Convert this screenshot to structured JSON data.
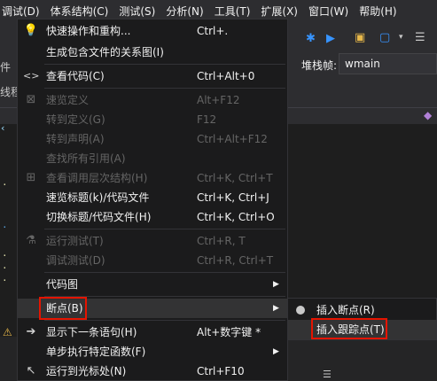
{
  "menubar": {
    "items": [
      "调试(D)",
      "体系结构(C)",
      "测试(S)",
      "分析(N)",
      "工具(T)",
      "扩展(X)",
      "窗口(W)",
      "帮助(H)"
    ]
  },
  "toolbar": {
    "stack_frame_label": "堆栈帧:",
    "stack_frame_value": "wmain",
    "fragments": [
      "件",
      "线程"
    ]
  },
  "context_menu": {
    "items": [
      {
        "label": "快速操作和重构...",
        "shortcut": "Ctrl+.",
        "icon": "lightbulb-icon",
        "enabled": true
      },
      {
        "label": "生成包含文件的关系图(I)",
        "shortcut": "",
        "icon": "",
        "enabled": true
      },
      {
        "label": "查看代码(C)",
        "shortcut": "Ctrl+Alt+0",
        "icon": "code-brackets-icon",
        "enabled": true
      },
      {
        "label": "速览定义",
        "shortcut": "Alt+F12",
        "icon": "peek-definition-icon",
        "enabled": false
      },
      {
        "label": "转到定义(G)",
        "shortcut": "F12",
        "icon": "",
        "enabled": false
      },
      {
        "label": "转到声明(A)",
        "shortcut": "Ctrl+Alt+F12",
        "icon": "",
        "enabled": false
      },
      {
        "label": "查找所有引用(A)",
        "shortcut": "",
        "icon": "",
        "enabled": false
      },
      {
        "label": "查看调用层次结构(H)",
        "shortcut": "Ctrl+K, Ctrl+T",
        "icon": "call-hierarchy-icon",
        "enabled": false
      },
      {
        "label": "速览标题(k)/代码文件",
        "shortcut": "Ctrl+K, Ctrl+J",
        "icon": "",
        "enabled": true
      },
      {
        "label": "切换标题/代码文件(H)",
        "shortcut": "Ctrl+K, Ctrl+O",
        "icon": "",
        "enabled": true
      },
      {
        "label": "运行测试(T)",
        "shortcut": "Ctrl+R, T",
        "icon": "run-test-icon",
        "enabled": false
      },
      {
        "label": "调试测试(D)",
        "shortcut": "Ctrl+R, Ctrl+T",
        "icon": "",
        "enabled": false
      },
      {
        "label": "代码图",
        "shortcut": "",
        "icon": "",
        "enabled": true,
        "submenu": true
      },
      {
        "label": "断点(B)",
        "shortcut": "",
        "icon": "",
        "enabled": true,
        "submenu": true,
        "highlighted": true
      },
      {
        "label": "显示下一条语句(H)",
        "shortcut": "Alt+数字键 *",
        "icon": "arrow-right-icon",
        "enabled": true
      },
      {
        "label": "单步执行特定函数(F)",
        "shortcut": "",
        "icon": "",
        "enabled": true,
        "submenu": true
      },
      {
        "label": "运行到光标处(N)",
        "shortcut": "Ctrl+F10",
        "icon": "cursor-icon",
        "enabled": true
      }
    ]
  },
  "breakpoint_submenu": {
    "items": [
      {
        "label": "插入断点(R)",
        "icon": "breakpoint-dot-icon"
      },
      {
        "label": "插入跟踪点(T)",
        "icon": "",
        "highlighted": true
      }
    ]
  },
  "colors": {
    "menu_bg": "#1b1b1c",
    "highlight_bg": "#333334",
    "disabled_text": "#656565",
    "annotation_red": "#e51400",
    "accent_blue": "#3794ff"
  }
}
